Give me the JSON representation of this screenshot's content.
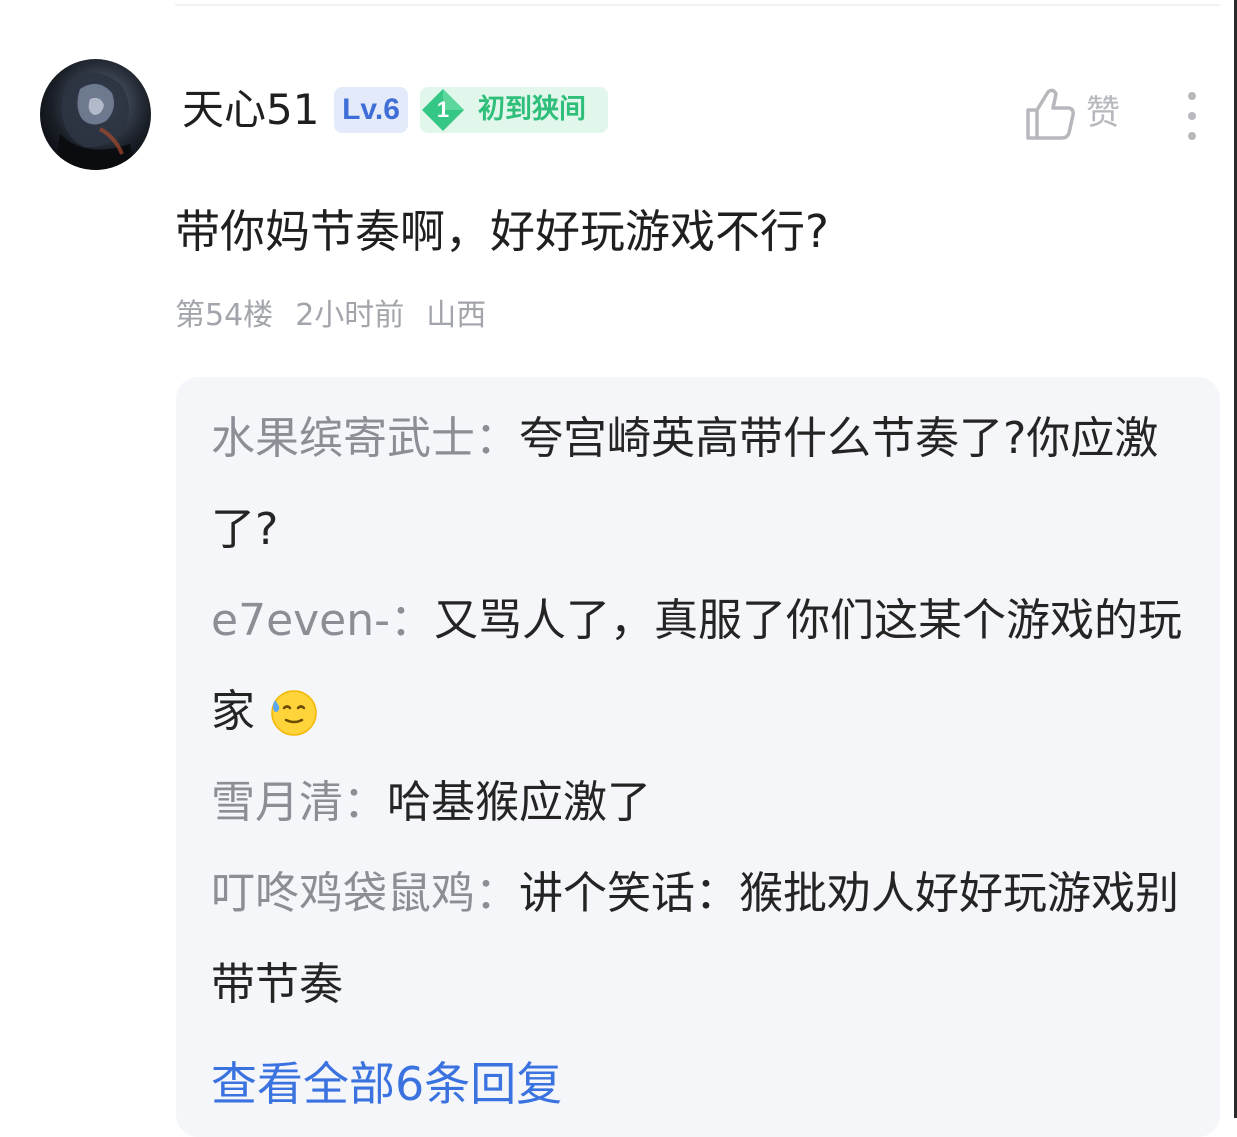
{
  "comment": {
    "user": {
      "name": "天心51",
      "level": "Lv.6",
      "rank_number": "1",
      "rank_title": "初到狭间"
    },
    "text": "带你妈节奏啊，好好玩游戏不行?",
    "meta": {
      "floor": "第54楼",
      "time": "2小时前",
      "location": "山西"
    },
    "actions": {
      "like_label": "赞"
    }
  },
  "replies": [
    {
      "author": "水果缤寄武士：",
      "text": "夸宫崎英高带什么节奏了?你应激了?"
    },
    {
      "author": "e7even-：",
      "text": "又骂人了，真服了你们这某个游戏的玩家",
      "emoji": "sweat-smile-emoji"
    },
    {
      "author": "雪月清：",
      "text": "哈基猴应激了"
    },
    {
      "author": "叮咚鸡袋鼠鸡：",
      "text": "讲个笑话：猴批劝人好好玩游戏别带节奏"
    }
  ],
  "view_all_label": "查看全部6条回复",
  "colors": {
    "accent_blue": "#3a72e0",
    "level_badge": "#3f6fd6",
    "rank_green": "#2fbf7a",
    "muted_text": "#a2a5ab",
    "reply_bg": "#f5f6f9"
  }
}
